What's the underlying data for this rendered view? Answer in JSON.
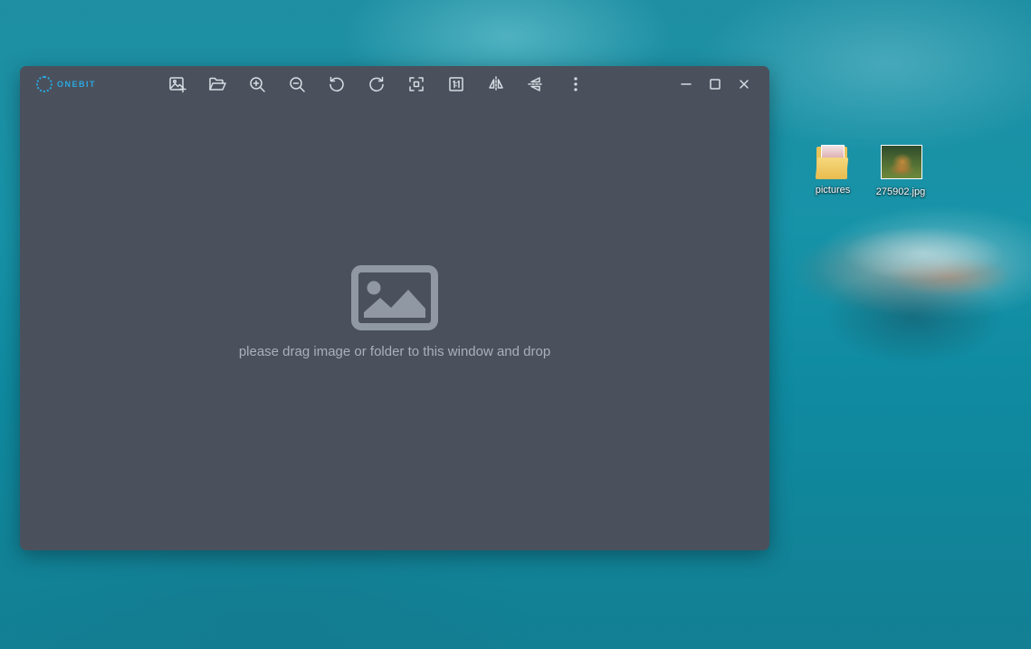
{
  "app": {
    "logo_text": "ONEBIT",
    "accent_color": "#2aa8e0",
    "window_bg": "#4a515d"
  },
  "toolbar": {
    "buttons": [
      {
        "name": "add-image",
        "icon": "image-plus-icon"
      },
      {
        "name": "open-folder",
        "icon": "folder-open-icon"
      },
      {
        "name": "zoom-in",
        "icon": "zoom-in-icon"
      },
      {
        "name": "zoom-out",
        "icon": "zoom-out-icon"
      },
      {
        "name": "rotate-left",
        "icon": "rotate-ccw-icon"
      },
      {
        "name": "rotate-right",
        "icon": "rotate-cw-icon"
      },
      {
        "name": "fit-screen",
        "icon": "fit-screen-icon"
      },
      {
        "name": "actual-size",
        "icon": "one-to-one-icon"
      },
      {
        "name": "flip-horizontal",
        "icon": "flip-horizontal-icon"
      },
      {
        "name": "flip-vertical",
        "icon": "flip-vertical-icon"
      },
      {
        "name": "more",
        "icon": "more-vertical-icon"
      }
    ]
  },
  "window_controls": {
    "minimize": "minimize-icon",
    "maximize": "maximize-icon",
    "close": "close-icon"
  },
  "main": {
    "placeholder_icon": "image-placeholder-icon",
    "hint": "please drag image or folder to this window and drop"
  },
  "desktop": {
    "icons": [
      {
        "label": "pictures",
        "icon": "folder-icon"
      },
      {
        "label": "275902.jpg",
        "icon": "image-file-icon"
      }
    ]
  }
}
